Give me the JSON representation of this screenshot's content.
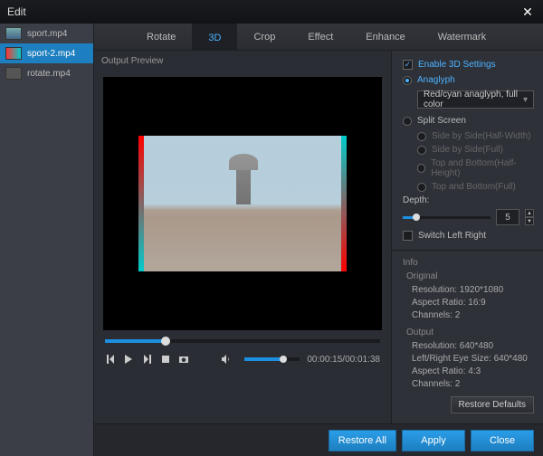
{
  "window": {
    "title": "Edit"
  },
  "files": [
    {
      "name": "sport.mp4",
      "selected": false
    },
    {
      "name": "sport-2.mp4",
      "selected": true
    },
    {
      "name": "rotate.mp4",
      "selected": false
    }
  ],
  "tabs": {
    "rotate": "Rotate",
    "threeD": "3D",
    "crop": "Crop",
    "effect": "Effect",
    "enhance": "Enhance",
    "watermark": "Watermark",
    "active": "3D"
  },
  "preview": {
    "label": "Output Preview"
  },
  "transport": {
    "position_pct": 22,
    "time": "00:00:15/00:01:38",
    "volume_pct": 70
  },
  "settings3d": {
    "enable_label": "Enable 3D Settings",
    "enable_checked": true,
    "anaglyph_label": "Anaglyph",
    "anaglyph_on": true,
    "anaglyph_mode": "Red/cyan anaglyph, full color",
    "split_label": "Split Screen",
    "split_on": false,
    "split_options": {
      "sbs_half": "Side by Side(Half-Width)",
      "sbs_full": "Side by Side(Full)",
      "tb_half": "Top and Bottom(Half-Height)",
      "tb_full": "Top and Bottom(Full)"
    },
    "depth_label": "Depth:",
    "depth_value": "5",
    "switch_label": "Switch Left Right",
    "switch_checked": false
  },
  "info": {
    "header": "Info",
    "original_header": "Original",
    "original": {
      "resolution": "Resolution: 1920*1080",
      "aspect": "Aspect Ratio: 16:9",
      "channels": "Channels: 2"
    },
    "output_header": "Output",
    "output": {
      "resolution": "Resolution: 640*480",
      "eyesize": "Left/Right Eye Size: 640*480",
      "aspect": "Aspect Ratio: 4:3",
      "channels": "Channels: 2"
    },
    "restore_defaults": "Restore Defaults"
  },
  "footer": {
    "restore_all": "Restore All",
    "apply": "Apply",
    "close": "Close"
  }
}
